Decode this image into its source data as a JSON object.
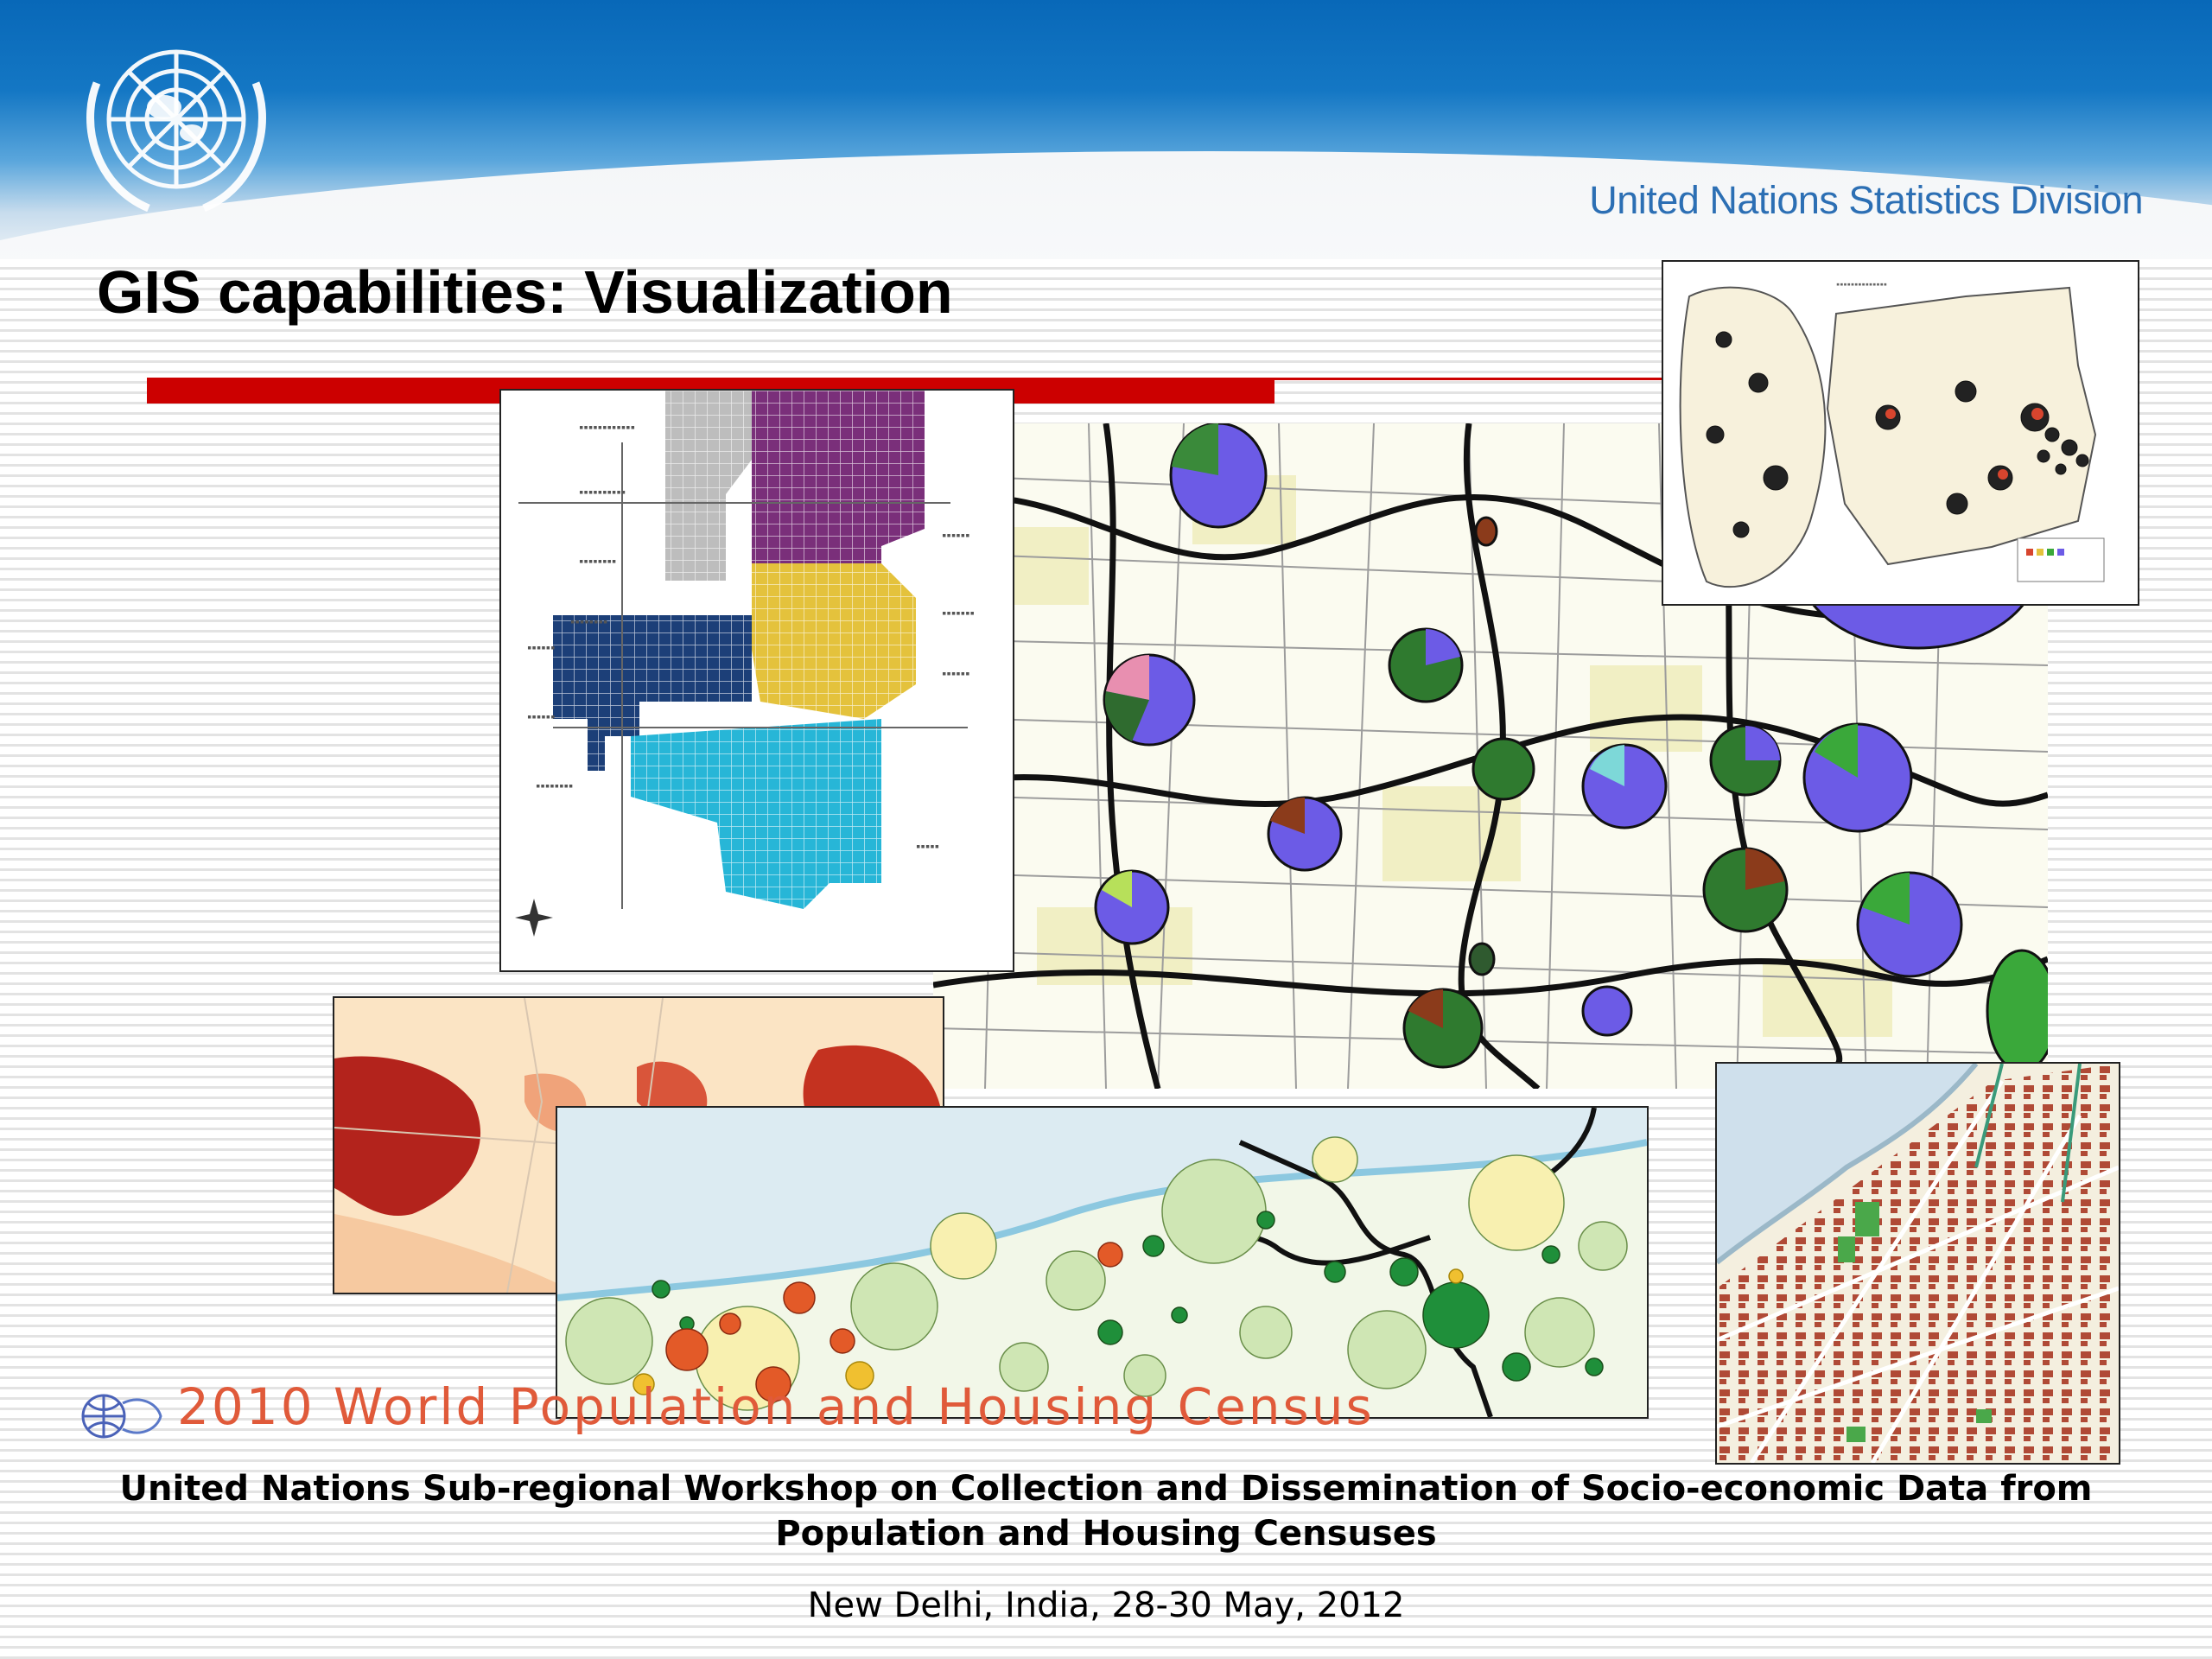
{
  "header": {
    "organization": "United Nations Statistics Division",
    "logo": "un-emblem-icon"
  },
  "slide": {
    "title": "GIS capabilities: Visualization"
  },
  "maps": [
    {
      "name": "pie-chart-city-map"
    },
    {
      "name": "colored-district-grid-map"
    },
    {
      "name": "small-country-pie-map"
    },
    {
      "name": "red-choropleth-map"
    },
    {
      "name": "proportional-circle-map"
    },
    {
      "name": "building-footprint-map"
    }
  ],
  "footer": {
    "census_banner": "2010 World Population and Housing Census",
    "workshop_line1": "United Nations Sub-regional Workshop on Collection and Dissemination of Socio-economic Data from",
    "workshop_line2": "Population and Housing Censuses",
    "place_date": "New Delhi, India, 28-30 May, 2012"
  },
  "colors": {
    "header_blue": "#0868b8",
    "accent_red": "#cc0000",
    "unsd_text": "#2c6fb4",
    "census_orange": "#e05a3a"
  }
}
